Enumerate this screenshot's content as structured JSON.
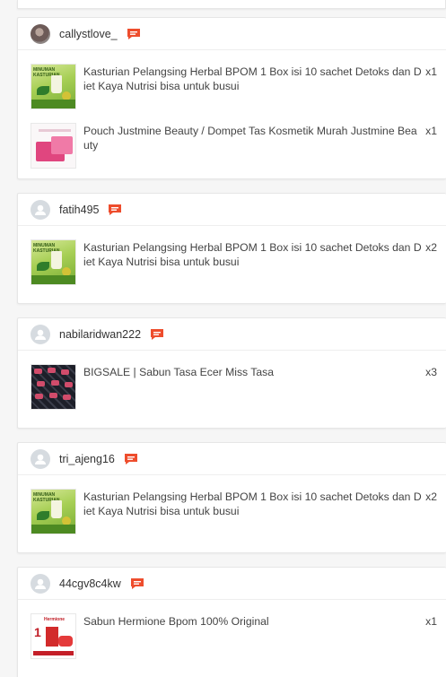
{
  "orders": [
    {
      "username": "callystlove_",
      "avatar": "photo",
      "items": [
        {
          "name": "Kasturian Pelangsing Herbal BPOM 1 Box isi 10 sachet Detoks dan Diet Kaya Nutrisi bisa untuk busui",
          "qty": "x1",
          "art": "kasturian"
        },
        {
          "name": "Pouch Justmine Beauty / Dompet Tas Kosmetik Murah Justmine Beauty",
          "qty": "x1",
          "art": "pouch"
        }
      ]
    },
    {
      "username": "fatih495",
      "avatar": "default",
      "items": [
        {
          "name": "Kasturian Pelangsing Herbal BPOM 1 Box isi 10 sachet Detoks dan Diet Kaya Nutrisi bisa untuk busui",
          "qty": "x2",
          "art": "kasturian"
        }
      ]
    },
    {
      "username": "nabilaridwan222",
      "avatar": "default",
      "items": [
        {
          "name": "BIGSALE | Sabun Tasa Ecer Miss Tasa",
          "qty": "x3",
          "art": "soap"
        }
      ]
    },
    {
      "username": "tri_ajeng16",
      "avatar": "default",
      "items": [
        {
          "name": "Kasturian Pelangsing Herbal BPOM 1 Box isi 10 sachet Detoks dan Diet Kaya Nutrisi bisa untuk busui",
          "qty": "x2",
          "art": "kasturian"
        }
      ]
    },
    {
      "username": "44cgv8c4kw",
      "avatar": "default",
      "items": [
        {
          "name": "Sabun Hermione Bpom 100% Original",
          "qty": "x1",
          "art": "hermione"
        }
      ]
    }
  ],
  "product_art_text": {
    "kasturian": "MINUMAN KASTURIAN",
    "hermione": "Hermione"
  },
  "colors": {
    "chat_icon": "#ee4d2d",
    "avatar_default": "#d6dbe0",
    "background": "#f6f6f6"
  },
  "icons": {
    "chat": "chat-bubble-icon",
    "default_avatar": "user-silhouette-icon"
  }
}
